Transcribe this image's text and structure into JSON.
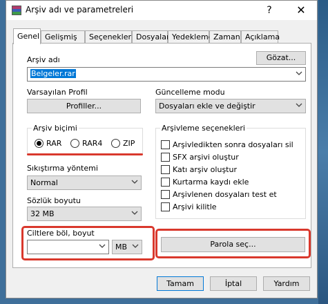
{
  "window": {
    "title": "Arşiv adı ve parametreleri",
    "help_glyph": "?",
    "close_glyph": "✕"
  },
  "tabs": [
    "Genel",
    "Gelişmiş",
    "Seçenekler",
    "Dosyalar",
    "Yedekleme",
    "Zaman",
    "Açıklama"
  ],
  "archive_name": {
    "label": "Arşiv adı",
    "value": "Belgeler.rar",
    "browse_label": "Gözat..."
  },
  "profile": {
    "label": "Varsayılan Profil",
    "button_label": "Profiller..."
  },
  "update_mode": {
    "label": "Güncelleme modu",
    "value": "Dosyaları ekle ve değiştir"
  },
  "archive_format": {
    "title": "Arşiv biçimi",
    "options": [
      "RAR",
      "RAR4",
      "ZIP"
    ],
    "selected": "RAR"
  },
  "compression": {
    "label": "Sıkıştırma yöntemi",
    "value": "Normal"
  },
  "dictionary": {
    "label": "Sözlük boyutu",
    "value": "32 MB"
  },
  "split": {
    "label": "Ciltlere böl, boyut",
    "value": "",
    "unit": "MB"
  },
  "archiving_options": {
    "title": "Arşivleme seçenekleri",
    "items": [
      "Arşivledikten sonra dosyaları sil",
      "SFX arşivi oluştur",
      "Katı arşiv oluştur",
      "Kurtarma kaydı ekle",
      "Arşivlenen dosyaları test et",
      "Arşivi kilitle"
    ]
  },
  "password_button": "Parola seç...",
  "footer": {
    "ok": "Tamam",
    "cancel": "İptal",
    "help": "Yardım"
  },
  "colors": {
    "highlight": "#d9382c",
    "selection": "#0078d7"
  }
}
